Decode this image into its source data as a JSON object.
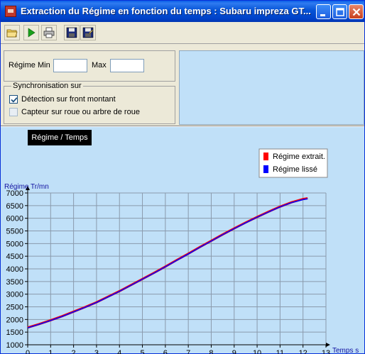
{
  "window": {
    "title": "Extraction du Régime en fonction du temps : Subaru impreza GT...",
    "controls": [
      "minimize",
      "maximize",
      "close"
    ]
  },
  "toolbar": {
    "buttons": [
      "open-folder-icon",
      "play-icon",
      "print-icon",
      "save-icon",
      "save-as-icon"
    ]
  },
  "regime": {
    "min_label": "Régime Min",
    "min_value": "",
    "max_label": "Max",
    "max_value": ""
  },
  "sync": {
    "group_title": "Synchronisation sur",
    "option1_label": "Détection sur front montant",
    "option1_checked": true,
    "option2_label": "Capteur sur roue ou arbre de roue",
    "option2_checked": false
  },
  "chart_button": {
    "label": "Régime / Temps"
  },
  "colors": {
    "title_bar": "#0553d6",
    "panel_bg": "#ece9d8",
    "plot_bg": "#c0e0f8",
    "extracted": "#ff0000",
    "smoothed": "#0000ff"
  },
  "chart_data": {
    "type": "line",
    "ylabel": "Régime Tr/mn",
    "xlabel": "Temps s",
    "xlim": [
      0,
      13
    ],
    "ylim": [
      1000,
      7000
    ],
    "x_ticks": [
      0,
      1,
      2,
      3,
      4,
      5,
      6,
      7,
      8,
      9,
      10,
      11,
      12,
      13
    ],
    "y_ticks": [
      1000,
      1500,
      2000,
      2500,
      3000,
      3500,
      4000,
      4500,
      5000,
      5500,
      6000,
      6500,
      7000
    ],
    "grid": true,
    "legend_position": "top-right",
    "series": [
      {
        "name": "Régime extrait.",
        "color": "#ff0000",
        "x": [
          0,
          0.5,
          1,
          1.5,
          2,
          2.5,
          3,
          3.5,
          4,
          4.5,
          5,
          5.5,
          6,
          6.5,
          7,
          7.5,
          8,
          8.5,
          9,
          9.5,
          10,
          10.5,
          11,
          11.5,
          12,
          12.2
        ],
        "y": [
          1680,
          1820,
          1970,
          2130,
          2310,
          2490,
          2680,
          2900,
          3120,
          3360,
          3600,
          3840,
          4090,
          4350,
          4600,
          4860,
          5110,
          5360,
          5600,
          5830,
          6050,
          6260,
          6460,
          6630,
          6760,
          6790
        ]
      },
      {
        "name": "Régime lissé",
        "color": "#0000ff",
        "x": [
          0,
          0.5,
          1,
          1.5,
          2,
          2.5,
          3,
          3.5,
          4,
          4.5,
          5,
          5.5,
          6,
          6.5,
          7,
          7.5,
          8,
          8.5,
          9,
          9.5,
          10,
          10.5,
          11,
          11.5,
          12,
          12.2
        ],
        "y": [
          1670,
          1810,
          1960,
          2120,
          2300,
          2480,
          2670,
          2890,
          3110,
          3350,
          3590,
          3830,
          4080,
          4340,
          4590,
          4850,
          5100,
          5350,
          5590,
          5820,
          6040,
          6250,
          6450,
          6620,
          6740,
          6770
        ]
      }
    ]
  }
}
